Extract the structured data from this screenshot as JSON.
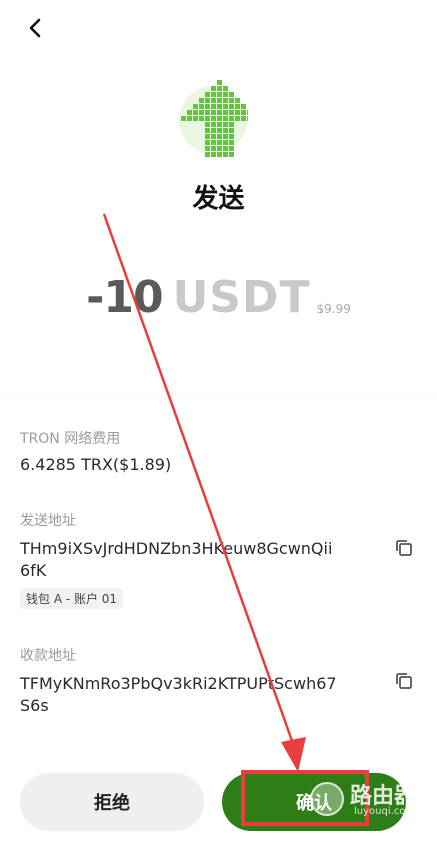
{
  "header": {
    "back_icon": "chevron-left-icon"
  },
  "hero": {
    "icon": "pixel-up-arrow-icon",
    "accent": "#5ec83a",
    "title": "发送"
  },
  "amount": {
    "value": "-10",
    "unit": "USDT",
    "usd": "$9.99"
  },
  "fee": {
    "label": "TRON 网络费用",
    "value": "6.4285 TRX($1.89)"
  },
  "from": {
    "label": "发送地址",
    "address": "THm9iXSvJrdHDNZbn3HKeuw8GcwnQii6fK",
    "account_tag": "钱包 A - 账户 01"
  },
  "to": {
    "label": "收款地址",
    "address": "TFMyKNmRo3PbQv3kRi2KTPUPtScwh67S6s"
  },
  "actions": {
    "reject_label": "拒绝",
    "confirm_label": "确认",
    "confirm_color": "#2f7d16"
  },
  "annotation": {
    "color": "#ea3d3d"
  },
  "watermark": {
    "title": "路由器",
    "subtitle": "luyouqi.com"
  }
}
